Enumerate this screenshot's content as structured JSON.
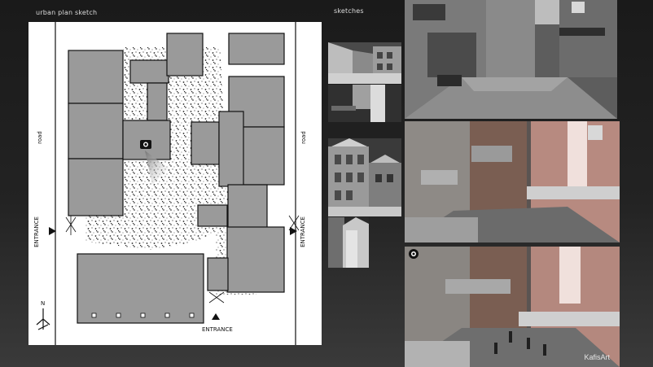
{
  "titles": {
    "plan": "urban plan sketch",
    "sketches": "sketches"
  },
  "plan": {
    "road_left": "road",
    "road_right": "road",
    "entrance_left": "ENTRANCE",
    "entrance_right": "ENTRANCE",
    "entrance_bottom": "ENTRANCE",
    "north": "N"
  },
  "renders": {
    "credit": "KafisArt"
  },
  "colors": {
    "background": "#232323",
    "building_fill": "#9a9a9a",
    "sheet": "#ffffff"
  },
  "icons": [
    "camera-icon",
    "north-arrow-icon",
    "entrance-arrow-icon"
  ]
}
